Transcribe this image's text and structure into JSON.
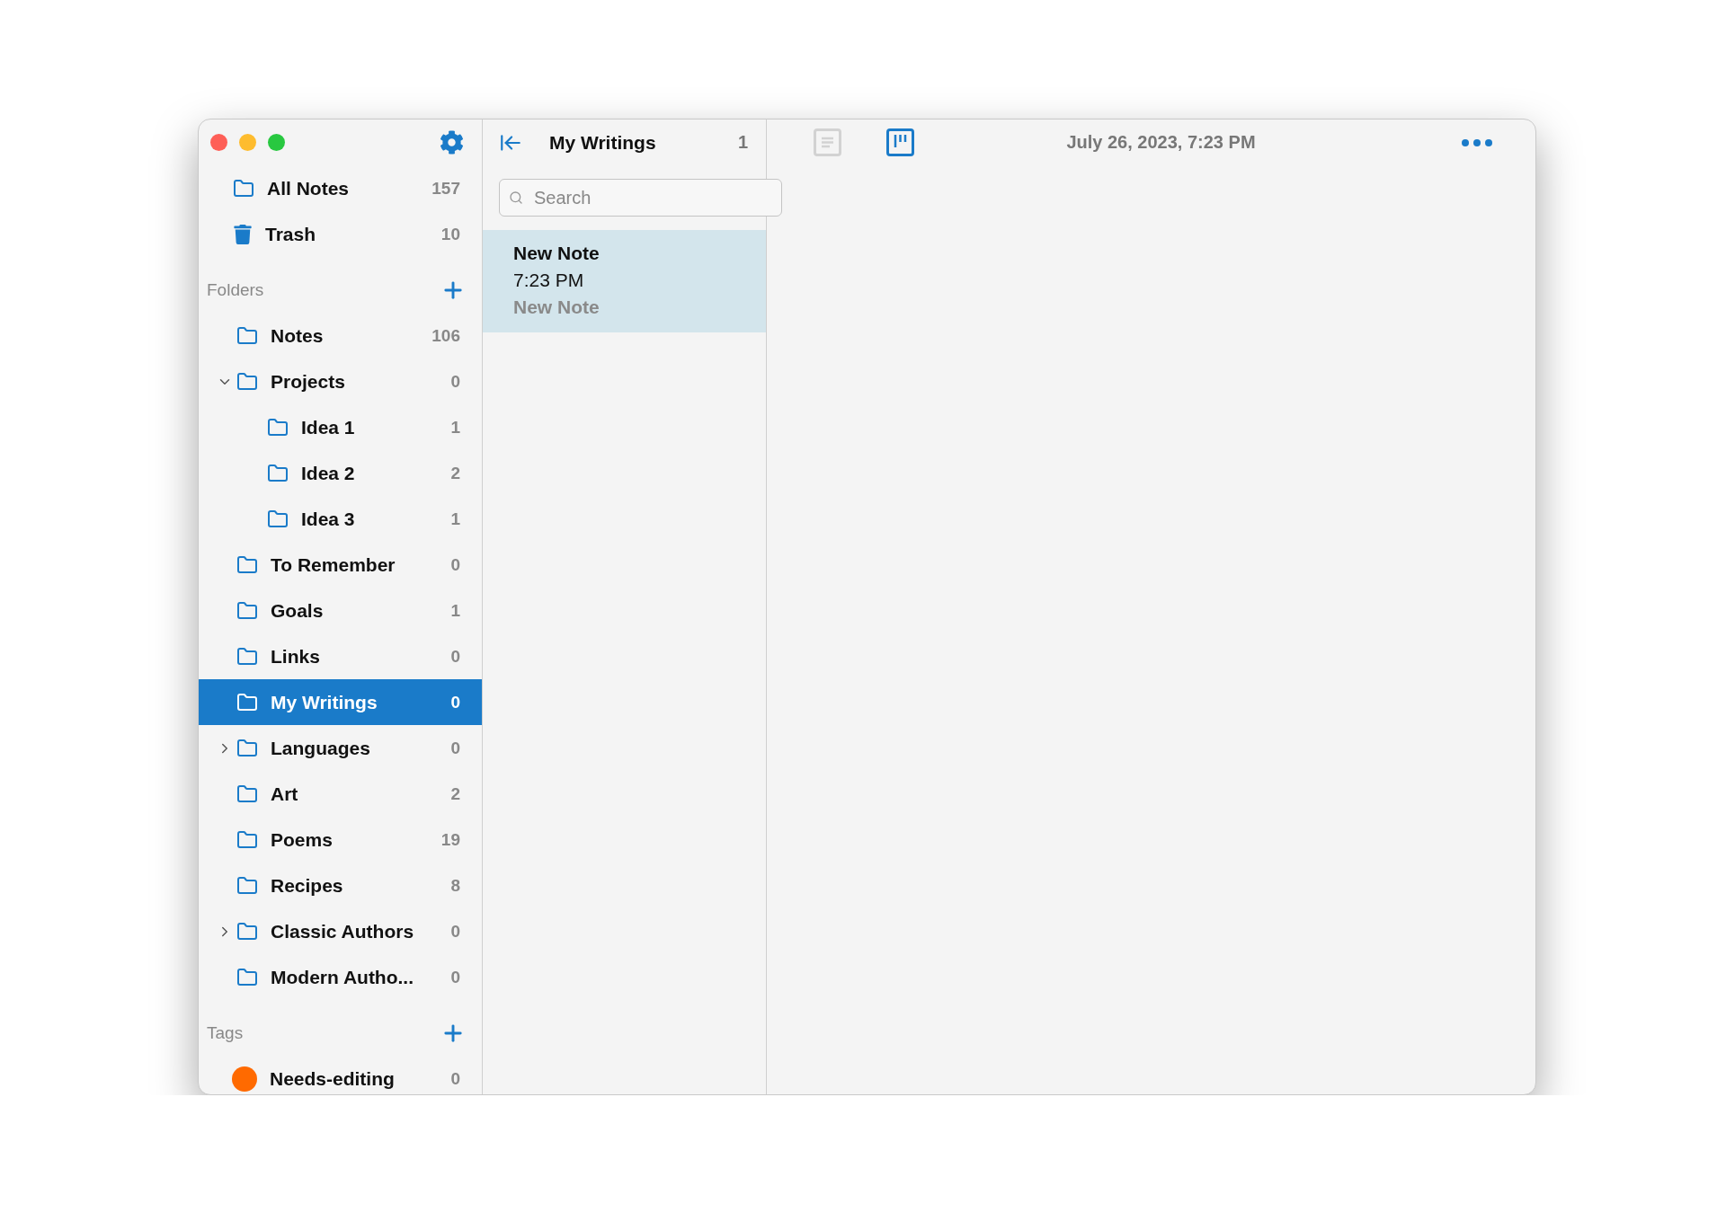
{
  "sidebar": {
    "all_notes": {
      "label": "All Notes",
      "count": "157"
    },
    "trash": {
      "label": "Trash",
      "count": "10"
    },
    "folders_header": "Folders",
    "folders": [
      {
        "label": "Notes",
        "count": "106",
        "selected": false
      },
      {
        "label": "Projects",
        "count": "0",
        "selected": false,
        "expanded": true,
        "children": [
          {
            "label": "Idea 1",
            "count": "1",
            "selected": false
          },
          {
            "label": "Idea 2",
            "count": "2",
            "selected": false
          },
          {
            "label": "Idea 3",
            "count": "1",
            "selected": false
          }
        ]
      },
      {
        "label": "To Remember",
        "count": "0",
        "selected": false
      },
      {
        "label": "Goals",
        "count": "1",
        "selected": false
      },
      {
        "label": "Links",
        "count": "0",
        "selected": false
      },
      {
        "label": "My Writings",
        "count": "0",
        "selected": true
      },
      {
        "label": "Languages",
        "count": "0",
        "selected": false,
        "expanded": false
      },
      {
        "label": "Art",
        "count": "2",
        "selected": false
      },
      {
        "label": "Poems",
        "count": "19",
        "selected": false
      },
      {
        "label": "Recipes",
        "count": "8",
        "selected": false
      },
      {
        "label": "Classic Authors",
        "count": "0",
        "selected": false,
        "expanded": false
      },
      {
        "label": "Modern Autho...",
        "count": "0",
        "selected": false
      }
    ],
    "tags_header": "Tags",
    "tags": [
      {
        "label": "Needs-editing",
        "count": "0",
        "color": "#ff6a00"
      }
    ]
  },
  "note_list": {
    "title": "My Writings",
    "count": "1",
    "search": {
      "placeholder": "Search"
    },
    "notes": [
      {
        "title": "New Note",
        "time": "7:23 PM",
        "preview": "New Note",
        "selected": true
      }
    ]
  },
  "editor": {
    "view_modes": [
      {
        "kind": "list",
        "selected": false
      },
      {
        "kind": "board",
        "selected": true
      }
    ],
    "date": "July 26, 2023, 7:23 PM"
  }
}
